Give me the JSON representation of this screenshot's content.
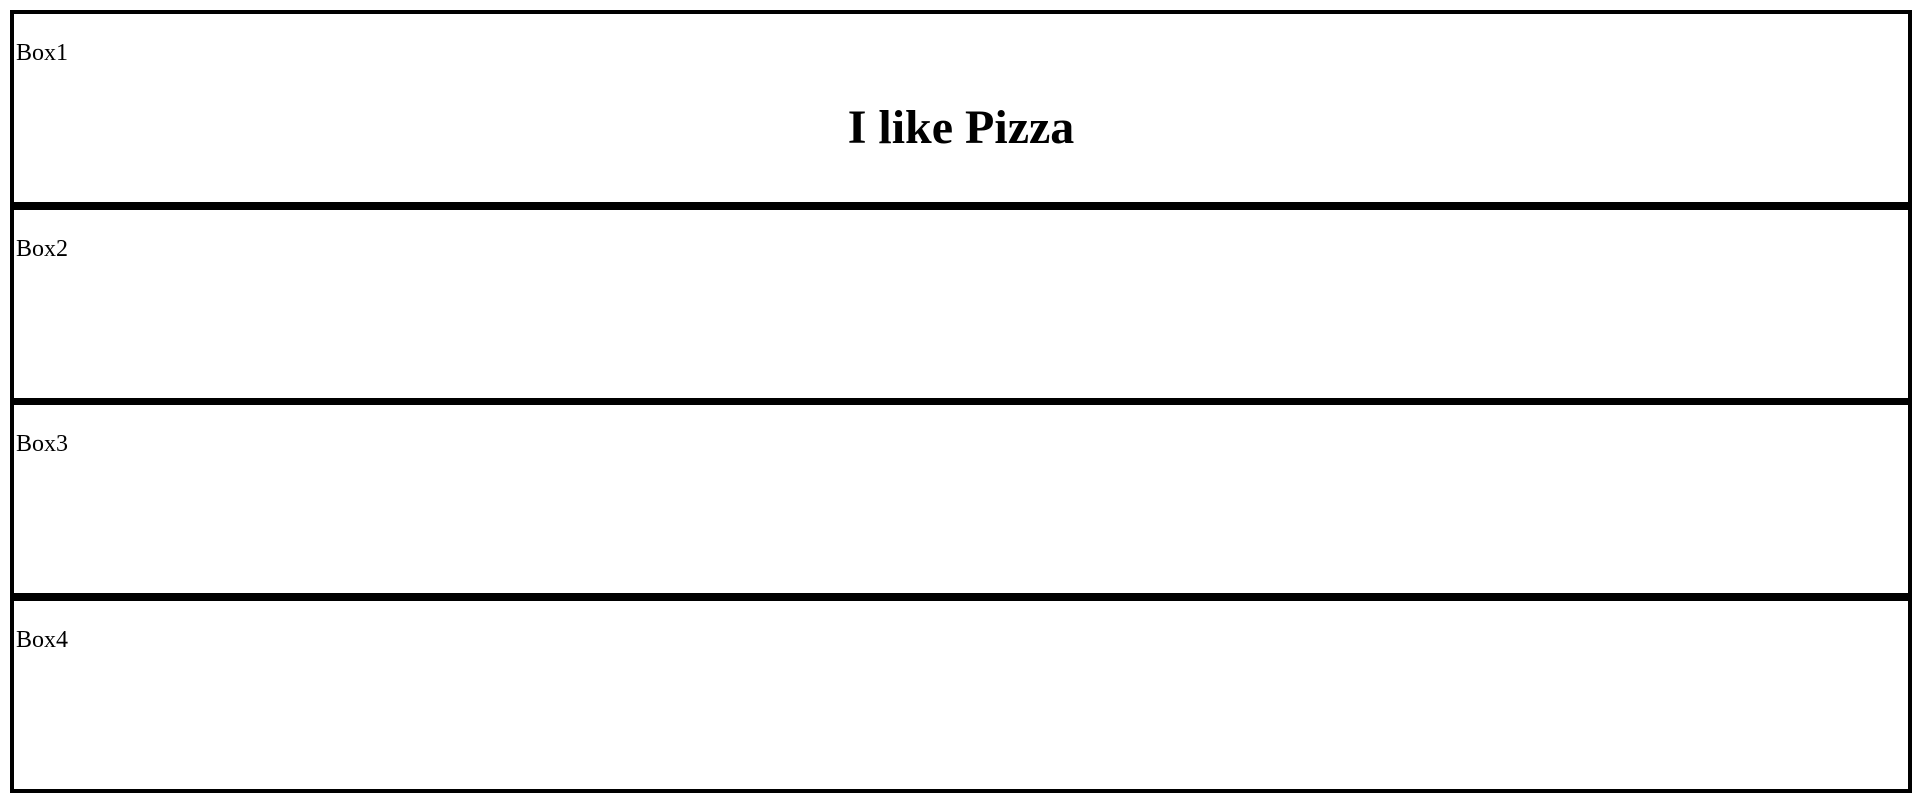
{
  "boxes": [
    {
      "label": "Box1",
      "headline": "I like Pizza"
    },
    {
      "label": "Box2"
    },
    {
      "label": "Box3"
    },
    {
      "label": "Box4"
    }
  ],
  "colors": {
    "background": "#ffffff",
    "border": "#000000",
    "text": "#000000"
  }
}
